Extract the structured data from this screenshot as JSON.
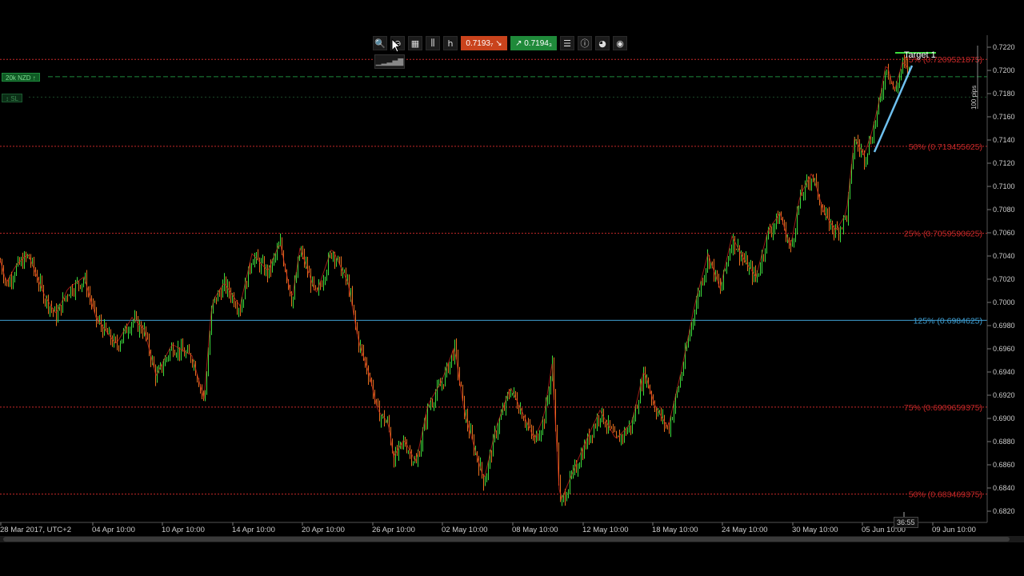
{
  "toolbar": {
    "buttons": [
      {
        "name": "zoom-in-icon",
        "glyph": "🔍"
      },
      {
        "name": "zoom-out-icon",
        "glyph": "⊖"
      },
      {
        "name": "chart-settings-icon",
        "glyph": "▦"
      },
      {
        "name": "chart-type-icon",
        "glyph": "⫼"
      },
      {
        "name": "timeframe-icon",
        "glyph": "h"
      }
    ],
    "sell_price": "0.7193₇",
    "buy_price": "0.7194₃",
    "tail_buttons": [
      {
        "name": "list-icon",
        "glyph": "☰"
      },
      {
        "name": "info-icon",
        "glyph": "ⓘ"
      },
      {
        "name": "drop-icon",
        "glyph": "◕"
      },
      {
        "name": "user-icon",
        "glyph": "◉"
      }
    ]
  },
  "position_tag": "20k NZD ↑",
  "sl_tag": "↕ SL",
  "target_label": "Target 1",
  "pips_label": "100 pips",
  "timer": "36:55",
  "y_axis": {
    "ticks": [
      "0.7220",
      "0.7200",
      "0.7180",
      "0.7160",
      "0.7140",
      "0.7120",
      "0.7100",
      "0.7080",
      "0.7060",
      "0.7040",
      "0.7020",
      "0.7000",
      "0.6980",
      "0.6960",
      "0.6940",
      "0.6920",
      "0.6900",
      "0.6880",
      "0.6860",
      "0.6840",
      "0.6820"
    ]
  },
  "x_axis": {
    "ticks": [
      "28 Mar 2017, UTC+2",
      "04 Apr 10:00",
      "10 Apr 10:00",
      "14 Apr 10:00",
      "20 Apr 10:00",
      "26 Apr 10:00",
      "02 May 10:00",
      "08 May 10:00",
      "12 May 10:00",
      "18 May 10:00",
      "24 May 10:00",
      "30 May 10:00",
      "05 Jun 10:00",
      "09 Jun 10:00"
    ]
  },
  "levels": [
    {
      "label": "75% (0.7209521875)",
      "price": 0.72095,
      "color": "#c62828"
    },
    {
      "label": "50% (0.713455625)",
      "price": 0.71346,
      "color": "#c62828"
    },
    {
      "label": "25% (0.7059590625)",
      "price": 0.70596,
      "color": "#c62828"
    },
    {
      "label": "125% (0.6984625)",
      "price": 0.69846,
      "color": "#3f9fd3"
    },
    {
      "label": "75% (0.6909659375)",
      "price": 0.69097,
      "color": "#c62828"
    },
    {
      "label": "50% (0.683469375)",
      "price": 0.68347,
      "color": "#c62828"
    }
  ],
  "position_line_price": 0.71946,
  "sl_line_price": 0.7177,
  "chart_data": {
    "type": "candlestick",
    "symbol_hint": "NZD",
    "ylim": [
      0.681,
      0.7225
    ],
    "price_path": [
      [
        0,
        0.7035
      ],
      [
        8,
        0.7015
      ],
      [
        20,
        0.703
      ],
      [
        35,
        0.704
      ],
      [
        55,
        0.7005
      ],
      [
        70,
        0.6988
      ],
      [
        85,
        0.701
      ],
      [
        105,
        0.702
      ],
      [
        120,
        0.6985
      ],
      [
        145,
        0.6962
      ],
      [
        165,
        0.6985
      ],
      [
        180,
        0.6975
      ],
      [
        195,
        0.6935
      ],
      [
        215,
        0.6962
      ],
      [
        240,
        0.6952
      ],
      [
        255,
        0.6915
      ],
      [
        265,
        0.6998
      ],
      [
        280,
        0.7015
      ],
      [
        300,
        0.6995
      ],
      [
        315,
        0.704
      ],
      [
        335,
        0.7025
      ],
      [
        350,
        0.705
      ],
      [
        365,
        0.7
      ],
      [
        375,
        0.7045
      ],
      [
        395,
        0.7005
      ],
      [
        415,
        0.7045
      ],
      [
        435,
        0.7015
      ],
      [
        448,
        0.6965
      ],
      [
        462,
        0.6935
      ],
      [
        472,
        0.6905
      ],
      [
        485,
        0.6895
      ],
      [
        492,
        0.6865
      ],
      [
        505,
        0.688
      ],
      [
        520,
        0.686
      ],
      [
        535,
        0.691
      ],
      [
        552,
        0.693
      ],
      [
        568,
        0.696
      ],
      [
        580,
        0.6905
      ],
      [
        590,
        0.688
      ],
      [
        605,
        0.6845
      ],
      [
        620,
        0.689
      ],
      [
        638,
        0.6925
      ],
      [
        652,
        0.6905
      ],
      [
        668,
        0.688
      ],
      [
        680,
        0.69
      ],
      [
        690,
        0.6945
      ],
      [
        700,
        0.6825
      ],
      [
        712,
        0.6845
      ],
      [
        730,
        0.6875
      ],
      [
        750,
        0.6905
      ],
      [
        770,
        0.688
      ],
      [
        790,
        0.6895
      ],
      [
        805,
        0.694
      ],
      [
        818,
        0.691
      ],
      [
        835,
        0.689
      ],
      [
        852,
        0.694
      ],
      [
        868,
        0.6995
      ],
      [
        885,
        0.704
      ],
      [
        900,
        0.701
      ],
      [
        915,
        0.7055
      ],
      [
        930,
        0.7035
      ],
      [
        945,
        0.702
      ],
      [
        960,
        0.706
      ],
      [
        975,
        0.7075
      ],
      [
        988,
        0.7045
      ],
      [
        1000,
        0.709
      ],
      [
        1015,
        0.711
      ],
      [
        1030,
        0.7075
      ],
      [
        1045,
        0.706
      ],
      [
        1058,
        0.7075
      ],
      [
        1068,
        0.714
      ],
      [
        1080,
        0.7125
      ],
      [
        1090,
        0.7145
      ],
      [
        1100,
        0.7175
      ],
      [
        1108,
        0.7205
      ],
      [
        1118,
        0.718
      ],
      [
        1128,
        0.7205
      ],
      [
        1136,
        0.72
      ]
    ]
  }
}
